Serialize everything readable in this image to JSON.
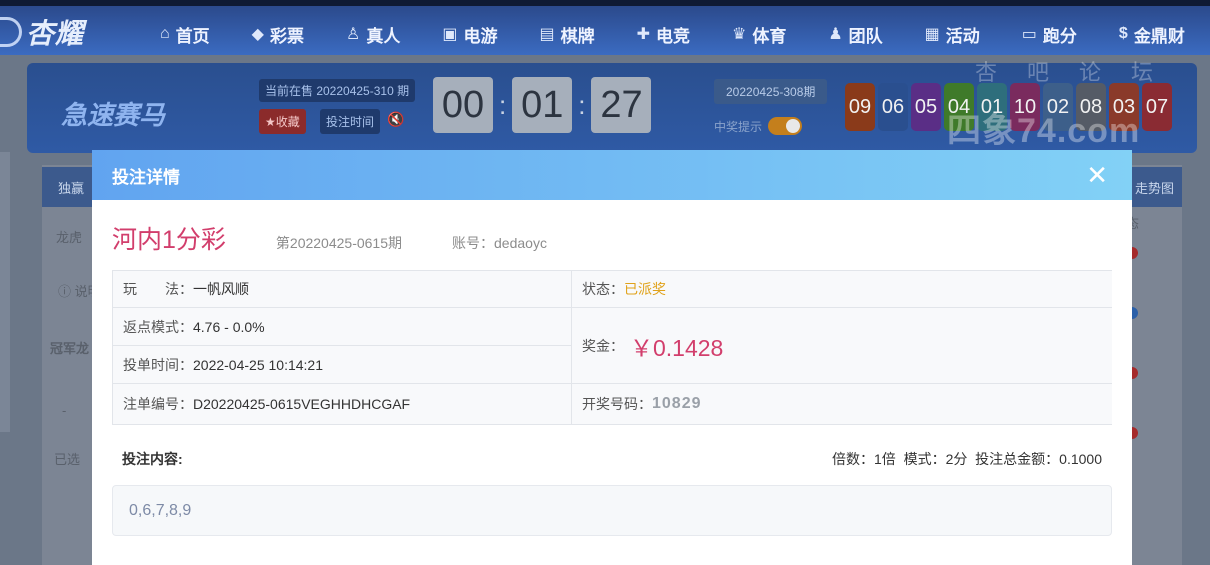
{
  "brand": {
    "logo_text": "杏耀"
  },
  "nav": [
    {
      "icon": "home-icon",
      "glyph": "⌂",
      "label": "首页"
    },
    {
      "icon": "lottery-icon",
      "glyph": "◆",
      "label": "彩票"
    },
    {
      "icon": "live-person-icon",
      "glyph": "♙",
      "label": "真人"
    },
    {
      "icon": "slot-icon",
      "glyph": "▣",
      "label": "电游"
    },
    {
      "icon": "cards-icon",
      "glyph": "▤",
      "label": "棋牌"
    },
    {
      "icon": "gamepad-icon",
      "glyph": "✚",
      "label": "电竞"
    },
    {
      "icon": "trophy-icon",
      "glyph": "♛",
      "label": "体育"
    },
    {
      "icon": "team-icon",
      "glyph": "♟",
      "label": "团队"
    },
    {
      "icon": "gift-icon",
      "glyph": "▦",
      "label": "活动"
    },
    {
      "icon": "car-icon",
      "glyph": "▭",
      "label": "跑分"
    },
    {
      "icon": "dollar-icon",
      "glyph": "$",
      "label": "金鼎财"
    }
  ],
  "game": {
    "logo": "急速赛马",
    "on_sale": "当前在售 20220425-310 期",
    "favorite": "★收藏",
    "bet_time": "投注时间",
    "countdown": [
      "00",
      "01",
      "27"
    ],
    "last_issue": "20220425-308期",
    "notify_label": "中奖提示",
    "balls": [
      {
        "n": "09",
        "color": "#8a3a1a"
      },
      {
        "n": "06",
        "color": "#2a4f8f"
      },
      {
        "n": "05",
        "color": "#5a2e86"
      },
      {
        "n": "04",
        "color": "#3f7a2a"
      },
      {
        "n": "01",
        "color": "#2e6e7c"
      },
      {
        "n": "10",
        "color": "#7a2b5e"
      },
      {
        "n": "02",
        "color": "#3d5f8a"
      },
      {
        "n": "08",
        "color": "#555b66"
      },
      {
        "n": "03",
        "color": "#8a3a2a"
      },
      {
        "n": "07",
        "color": "#8a2b33"
      }
    ]
  },
  "watermark": {
    "top": "杏吧论坛",
    "main": "四象74.com"
  },
  "background": {
    "tab1": "独赢",
    "row1": "龙虎",
    "note": "说明",
    "section": "冠军龙",
    "minus": "-",
    "selected": "已选",
    "chart": "走势图",
    "state": "态"
  },
  "modal": {
    "title": "投注详情",
    "close": "✕",
    "lottery_name": "河内1分彩",
    "issue": "第20220425-0615期",
    "account_label": "账号：",
    "account_value": "dedaoyc",
    "play_label": "玩　　法：",
    "play_value": "一帆风顺",
    "status_label": "状态：",
    "status_value": "已派奖",
    "rebate_label": "返点模式：",
    "rebate_value": "4.76 - 0.0%",
    "prize_label": "奖金：",
    "prize_value": "￥0.1428",
    "time_label": "投单时间：",
    "time_value": "2022-04-25 10:14:21",
    "order_label": "注单编号：",
    "order_value": "D20220425-0615VEGHHDHCGAF",
    "draw_label": "开奖号码：",
    "draw_value": "10829",
    "content_label": "投注内容:",
    "multiple_label": "倍数：",
    "multiple_value": "1倍",
    "mode_label": "模式：",
    "mode_value": "2分",
    "total_label": "投注总金额：",
    "total_value": "0.1000",
    "content_value": "0,6,7,8,9"
  }
}
